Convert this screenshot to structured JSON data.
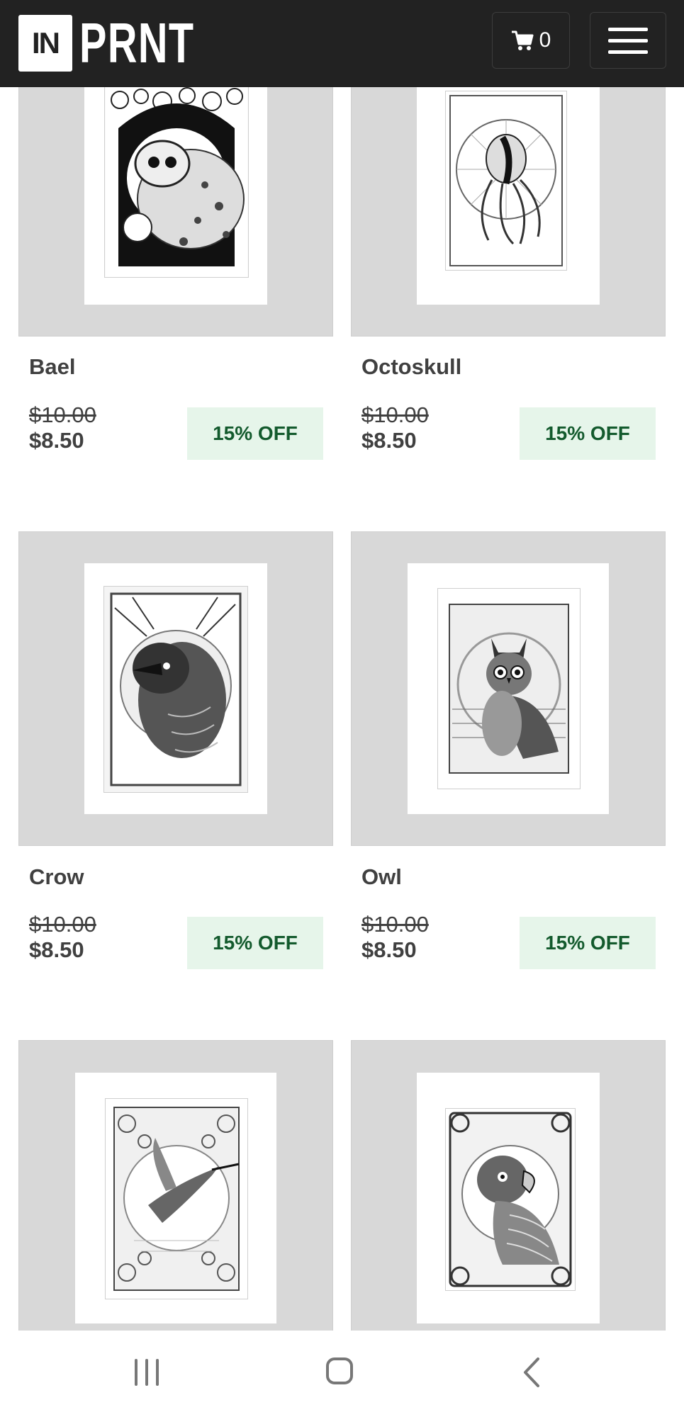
{
  "header": {
    "logo_box": "IN",
    "logo_text": "PRNT",
    "cart_count": "0",
    "cart_icon": "cart-icon",
    "menu_icon": "hamburger-menu-icon"
  },
  "products": [
    {
      "title": "Bael",
      "old_price": "$10.00",
      "price": "$8.50",
      "badge": "15% OFF"
    },
    {
      "title": "Octoskull",
      "old_price": "$10.00",
      "price": "$8.50",
      "badge": "15% OFF"
    },
    {
      "title": "Crow",
      "old_price": "$10.00",
      "price": "$8.50",
      "badge": "15% OFF"
    },
    {
      "title": "Owl",
      "old_price": "$10.00",
      "price": "$8.50",
      "badge": "15% OFF"
    },
    {
      "title": "",
      "old_price": "",
      "price": "",
      "badge": ""
    },
    {
      "title": "",
      "old_price": "",
      "price": "",
      "badge": ""
    }
  ],
  "colors": {
    "header_bg": "#222222",
    "card_bg": "#d8d8d8",
    "badge_bg": "#e6f5ea",
    "badge_text": "#135a2d",
    "text": "#404040"
  },
  "system_nav": {
    "recent_icon": "recent-apps-icon",
    "home_icon": "home-icon",
    "back_icon": "back-icon"
  }
}
